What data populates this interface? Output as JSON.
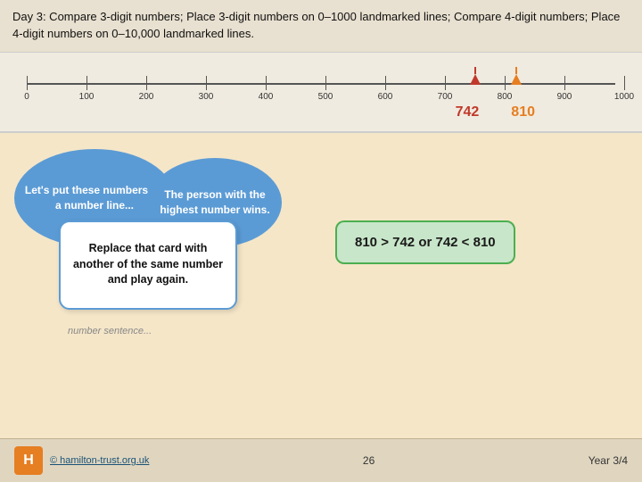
{
  "instruction": {
    "text": "Day 3: Compare 3-digit numbers; Place 3-digit numbers on 0–1000 landmarked lines; Compare 4-digit numbers; Place 4-digit numbers on 0–10,000 landmarked lines."
  },
  "numberLine": {
    "ticks": [
      0,
      100,
      200,
      300,
      400,
      500,
      600,
      700,
      800,
      900,
      1000
    ],
    "markers": [
      {
        "value": 742,
        "label": "742",
        "color": "#c0392b"
      },
      {
        "value": 810,
        "label": "810",
        "color": "#e67e22"
      }
    ]
  },
  "bubbles": {
    "left": "Let's put these numbers on a number line...",
    "right": "The person with the highest number wins.",
    "center": "Replace that card with another of the same number and play again.",
    "faded": "number sentence..."
  },
  "result": {
    "text": "810 > 742 or 742 < 810"
  },
  "footer": {
    "link_text": "© hamilton-trust.org.uk",
    "page": "26",
    "year": "Year 3/4"
  }
}
